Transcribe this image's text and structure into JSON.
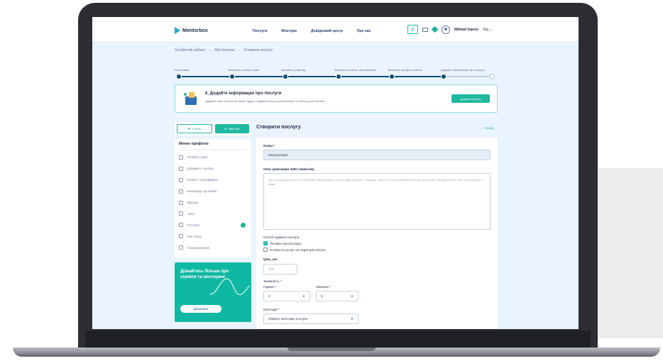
{
  "header": {
    "brand": "Mentorbox",
    "nav": [
      "Послуги",
      "Ментори",
      "Довідковий центр",
      "Про нас"
    ],
    "search_icon": "search-icon",
    "user_name": "Mikhail Ivanov",
    "lang": "Укр"
  },
  "breadcrumb": {
    "items": [
      "Особистий кабінет",
      "Мої послуги",
      "Створити послугу"
    ],
    "separator": "→"
  },
  "stepper": {
    "steps": [
      {
        "label": "Реєстрація",
        "done": true
      },
      {
        "label": "Заповніть особисті дані",
        "done": true
      },
      {
        "label": "Заповніть розклад",
        "done": true
      },
      {
        "label": "Заповніть роботу і кваліфікацію",
        "done": true
      },
      {
        "label": "Заповніть профіль роботи",
        "done": true
      },
      {
        "label": "Додайте інформацію про послуги",
        "done": true
      },
      {
        "label": "",
        "done": false
      }
    ]
  },
  "banner": {
    "title": "6. Додайте інформацію про послуги",
    "text": "Додайте свої послуги по якими будуть надавати вашу консультацію та роботу для клієнтів.",
    "button": "Додати послугу"
  },
  "sidebar": {
    "toggle": {
      "left": "Учень",
      "right": "Ментор"
    },
    "menu_title": "Меню профілю",
    "items": [
      "Особисті дані",
      "Документ і досвід",
      "Освіта і сертифікати",
      "Календар зустрічей",
      "Відгуки",
      "Чати",
      "Послуги",
      "Мої гроші",
      "Налаштування"
    ],
    "promo_text": "Дізнайтесь більше про сервіси та менторинг",
    "promo_button": "Дізнатися"
  },
  "form": {
    "title": "Створити послугу",
    "back_link": "← Назад",
    "name_label": "Назва *",
    "name_value": "Консультація",
    "desc_label": "Опис (максимум 4000 символів)",
    "desc_placeholder": "Про що ваша послуга, які проблеми вона вирішує та кому буде корисна. Розкажіть, для кого вона призначена та які результати отримає клієнт після консультації з вами.",
    "format_label": "Спосіб надання послуги",
    "format_options": [
      {
        "label": "Онлайн консультація",
        "checked": true
      },
      {
        "label": "Особиста зустріч на території клієнта",
        "checked": false
      }
    ],
    "price_label": "Ціна, грн",
    "price_placeholder": "100",
    "duration_label": "Тривалість *",
    "hours_label": "Години *",
    "hours_value": "0",
    "minutes_label": "Хвилини *",
    "minutes_value": "0",
    "category_label": "Категорія *",
    "category_value": "Оберіть категорію послуги"
  }
}
